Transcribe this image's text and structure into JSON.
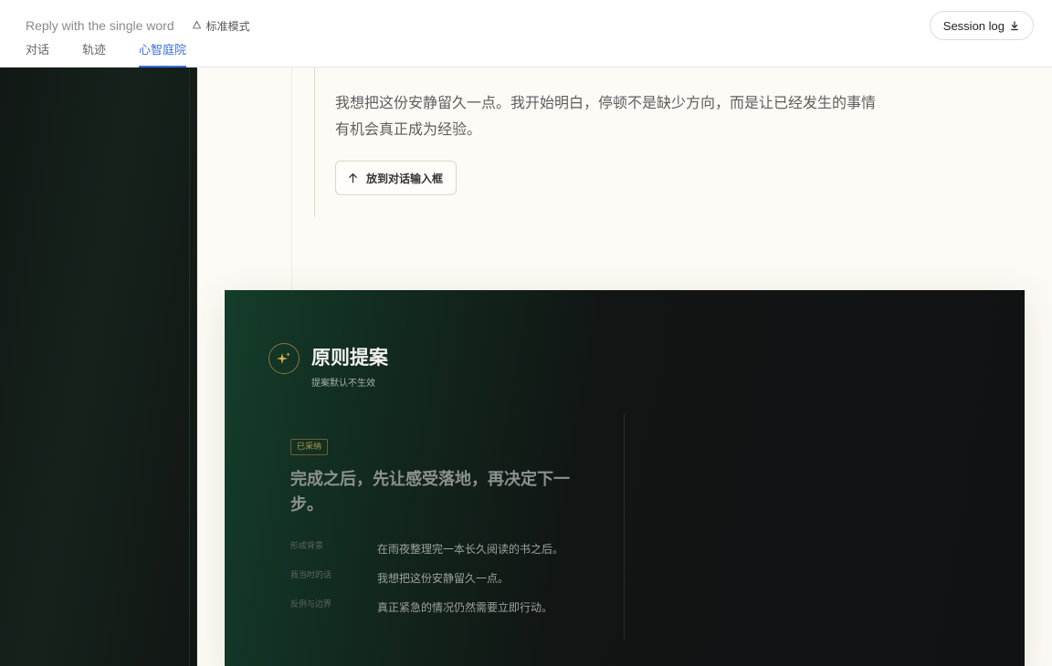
{
  "header": {
    "session_title": "Reply with the single word",
    "mode_label": "标准模式",
    "session_log_label": "Session log",
    "tabs": [
      {
        "label": "对话",
        "active": false
      },
      {
        "label": "轨迹",
        "active": false
      },
      {
        "label": "心智庭院",
        "active": true
      }
    ]
  },
  "quote": {
    "text": "我想把这份安静留久一点。我开始明白，停顿不是缺少方向，而是让已经发生的事情有机会真正成为经验。",
    "button_label": "放到对话输入框"
  },
  "proposal_card": {
    "title": "原则提案",
    "subtitle": "提案默认不生效",
    "badge": "已采纳",
    "principle": "完成之后，先让感受落地，再决定下一步。",
    "details": [
      {
        "label": "形成背景",
        "value": "在雨夜整理完一本长久阅读的书之后。"
      },
      {
        "label": "我当时的话",
        "value": "我想把这份安静留久一点。"
      },
      {
        "label": "反例与边界",
        "value": "真正紧急的情况仍然需要立即行动。"
      }
    ]
  },
  "colors": {
    "accent_blue": "#3b6fd4",
    "gold": "#b69a48",
    "cream": "#fdfbf6",
    "card_dark": "#111214",
    "card_green": "#143d2a"
  },
  "icons": {
    "mode": "recycle-icon",
    "session_log": "download-icon",
    "to_input": "arrow-up-icon",
    "card": "sparkle-icon"
  }
}
